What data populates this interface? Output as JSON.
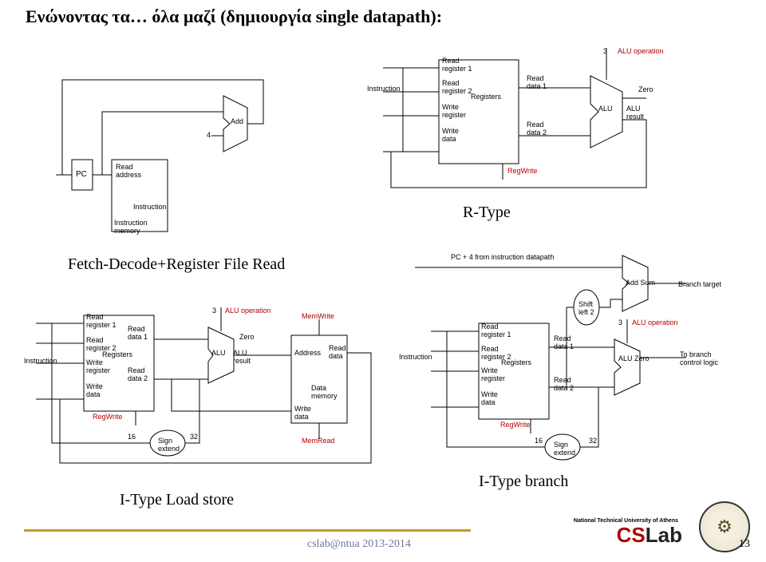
{
  "title": "Ενώνοντας τα… όλα μαζί (δημιουργία single datapath):",
  "sections": {
    "rtype": "R-Type",
    "fetch": "Fetch-Decode+Register File Read",
    "load": "I-Type Load store",
    "branch": "I-Type branch"
  },
  "footer": {
    "course": "cslab@ntua 2013-2014",
    "page": "13",
    "inst": "National Technical University of Athens",
    "logo": {
      "c": "CS",
      "s": "Lab"
    }
  },
  "labels": {
    "pc": "PC",
    "readaddr": "Read\naddress",
    "instrmem": "Instruction\nmemory",
    "instr": "Instruction",
    "add": "Add",
    "four": "4",
    "rr1": "Read\nregister 1",
    "rr2": "Read\nregister 2",
    "wr": "Write\nregister",
    "wd": "Write\ndata",
    "regs": "Registers",
    "rd1": "Read\ndata 1",
    "rd2": "Read\ndata 2",
    "regwrite": "RegWrite",
    "alu": "ALU",
    "aluop": "ALU operation",
    "three": "3",
    "zero": "Zero",
    "alures": "ALU\nresult",
    "aluzero": "ALU  Zero",
    "memwrite": "MemWrite",
    "memread": "MemRead",
    "addr": "Address",
    "rdata": "Read\ndata",
    "datamem": "Data\nmemory",
    "sixteen": "16",
    "thirtytwo": "32",
    "signext": "Sign\nextend",
    "pc4": "PC + 4 from instruction datapath",
    "addsum": "Add  Sum",
    "branchtgt": "Branch target",
    "shift": "Shift\nleft 2",
    "tobranch": "To branch\ncontrol logic"
  }
}
